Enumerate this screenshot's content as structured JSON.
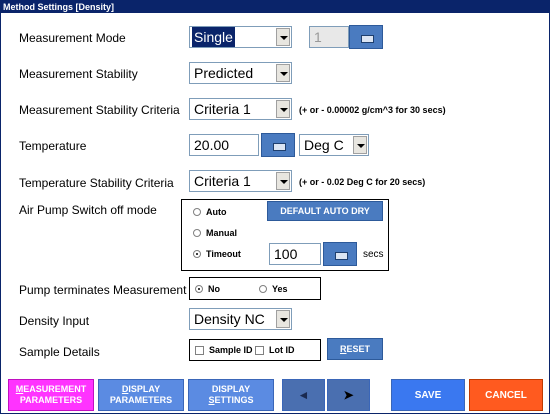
{
  "window": {
    "title": "Method Settings  [Density]"
  },
  "fields": {
    "measurement_mode": {
      "label": "Measurement Mode",
      "value": "Single",
      "count": "1"
    },
    "measurement_stability": {
      "label": "Measurement Stability",
      "value": "Predicted"
    },
    "stability_criteria": {
      "label": "Measurement Stability Criteria",
      "value": "Criteria 1",
      "hint": "(+ or -  0.00002 g/cm^3 for 30 secs)"
    },
    "temperature": {
      "label": "Temperature",
      "value": "20.00",
      "unit": "Deg C"
    },
    "temp_stability_criteria": {
      "label": "Temperature Stability Criteria",
      "value": "Criteria 1",
      "hint": "(+ or -  0.02 Deg C for 20 secs)"
    },
    "air_pump": {
      "label": "Air Pump Switch off mode",
      "options": [
        "Auto",
        "Manual",
        "Timeout"
      ],
      "selected": "Timeout",
      "default_button": "DEFAULT AUTO DRY",
      "timeout_value": "100",
      "timeout_unit": "secs"
    },
    "pump_terminates": {
      "label": "Pump terminates Measurement",
      "options": [
        "No",
        "Yes"
      ],
      "selected": "No"
    },
    "density_input": {
      "label": "Density Input",
      "value": "Density NC"
    },
    "sample_details": {
      "label": "Sample Details",
      "options": [
        "Sample ID",
        "Lot ID"
      ],
      "reset_first": "R",
      "reset_rest": "ESET"
    }
  },
  "bottom": {
    "measurement": {
      "first": "M",
      "rest": "EASUREMENT",
      "line2": "PARAMETERS",
      "color": "#ff33ff"
    },
    "display_params": {
      "first": "D",
      "rest": "ISPLAY",
      "line2": "PARAMETERS"
    },
    "display_settings": {
      "line1": "DISPLAY",
      "first": "S",
      "rest": "ETTINGS"
    },
    "save": "SAVE",
    "cancel": "CANCEL",
    "cancel_color": "#ff5a1f",
    "save_color": "#3a78f0"
  }
}
